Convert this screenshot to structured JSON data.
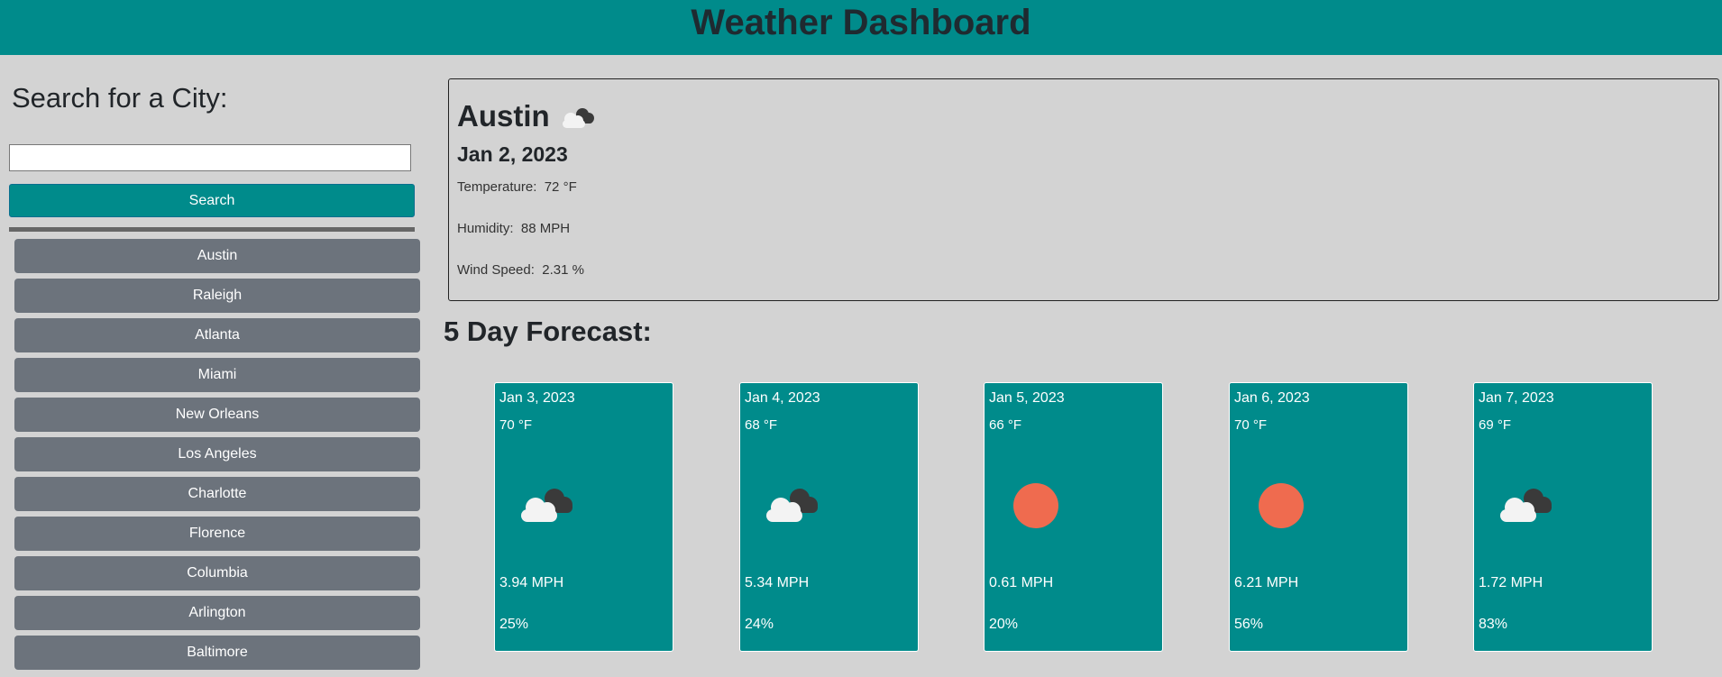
{
  "header": {
    "title": "Weather Dashboard"
  },
  "sidebar": {
    "heading": "Search for a City:",
    "search_value": "",
    "search_button": "Search",
    "cities": [
      "Austin",
      "Raleigh",
      "Atlanta",
      "Miami",
      "New Orleans",
      "Los Angeles",
      "Charlotte",
      "Florence",
      "Columbia",
      "Arlington",
      "Baltimore"
    ]
  },
  "current": {
    "city": "Austin",
    "icon": "partly-cloudy-icon",
    "date": "Jan 2, 2023",
    "temperature_label": "Temperature:",
    "temperature_value": "72 °F",
    "humidity_label": "Humidity:",
    "humidity_value": "88 MPH",
    "wind_label": "Wind Speed:",
    "wind_value": "2.31 %"
  },
  "forecast": {
    "title": "5 Day Forecast:",
    "days": [
      {
        "date": "Jan 3, 2023",
        "temp": "70 °F",
        "icon": "cloud-icon",
        "wind": "3.94 MPH",
        "humidity": "25%"
      },
      {
        "date": "Jan 4, 2023",
        "temp": "68 °F",
        "icon": "cloud-icon",
        "wind": "5.34 MPH",
        "humidity": "24%"
      },
      {
        "date": "Jan 5, 2023",
        "temp": "66 °F",
        "icon": "sun-icon",
        "wind": "0.61 MPH",
        "humidity": "20%"
      },
      {
        "date": "Jan 6, 2023",
        "temp": "70 °F",
        "icon": "sun-icon",
        "wind": "6.21 MPH",
        "humidity": "56%"
      },
      {
        "date": "Jan 7, 2023",
        "temp": "69 °F",
        "icon": "cloud-icon",
        "wind": "1.72 MPH",
        "humidity": "83%"
      }
    ]
  },
  "colors": {
    "header": "#008b8b",
    "background": "#d3d3d3",
    "city_button": "#6c737c",
    "sun": "#ef6b4f"
  }
}
